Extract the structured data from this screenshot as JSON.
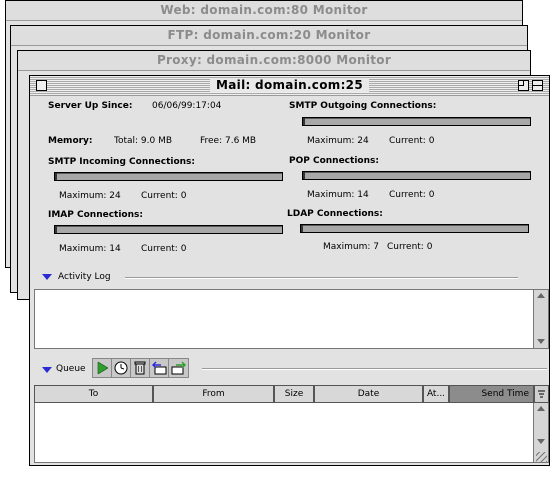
{
  "background_windows": [
    {
      "title": "Web: domain.com:80 Monitor"
    },
    {
      "title": "FTP: domain.com:20 Monitor"
    },
    {
      "title": "Proxy: domain.com:8000 Monitor"
    }
  ],
  "window": {
    "title": "Mail: domain.com:25",
    "server_up_label": "Server Up Since:",
    "server_up_value": "06/06/99:17:04",
    "memory_label": "Memory:",
    "memory_total": "Total: 9.0 MB",
    "memory_free": "Free: 7.6 MB",
    "connections": {
      "smtp_out": {
        "label": "SMTP Outgoing Connections:",
        "maximum": "Maximum: 24",
        "current": "Current: 0",
        "fraction": 0.0
      },
      "smtp_in": {
        "label": "SMTP Incoming Connections:",
        "maximum": "Maximum: 24",
        "current": "Current: 0",
        "fraction": 0.0
      },
      "pop": {
        "label": "POP Connections:",
        "maximum": "Maximum: 14",
        "current": "Current: 0",
        "fraction": 0.0
      },
      "imap": {
        "label": "IMAP Connections:",
        "maximum": "Maximum: 14",
        "current": "Current: 0",
        "fraction": 0.0
      },
      "ldap": {
        "label": "LDAP Connections:",
        "maximum": "Maximum: 7",
        "current": "Current: 0",
        "fraction": 0.0
      }
    },
    "activity_log_label": "Activity Log",
    "queue_label": "Queue",
    "queue_toolbar": [
      {
        "icon": "play-icon"
      },
      {
        "icon": "clock-icon"
      },
      {
        "icon": "trash-icon"
      },
      {
        "icon": "return-mail-icon"
      },
      {
        "icon": "forward-mail-icon"
      }
    ],
    "queue_columns": [
      "To",
      "From",
      "Size",
      "Date",
      "At...",
      "Send Time"
    ],
    "colors": {
      "accent_triangle": "#2b2bd6",
      "play_green": "#2e9e2e"
    }
  }
}
